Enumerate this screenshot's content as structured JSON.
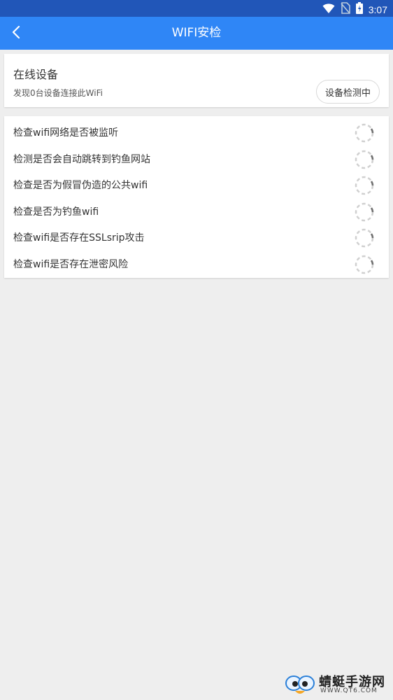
{
  "status_bar": {
    "time": "3:07"
  },
  "app_bar": {
    "title": "WIFI安检"
  },
  "online_devices": {
    "title": "在线设备",
    "subtitle": "发现0台设备连接此WiFi",
    "button_label": "设备检测中"
  },
  "checks": [
    {
      "label": "检查wifi网络是否被监听"
    },
    {
      "label": "检测是否会自动跳转到钓鱼网站"
    },
    {
      "label": "检查是否为假冒伪造的公共wifi"
    },
    {
      "label": "检查是否为钓鱼wifi"
    },
    {
      "label": "检查wifi是否存在SSLsrip攻击"
    },
    {
      "label": "检查wifi是否存在泄密风险"
    }
  ],
  "watermark": {
    "name": "蜻蜓手游网",
    "url": "WWW.QT6.COM"
  },
  "colors": {
    "status_bar": "#2156b8",
    "app_bar": "#2f86f6",
    "background": "#eeeeee"
  },
  "icons": [
    "wifi-icon",
    "no-sim-icon",
    "battery-icon",
    "back-arrow-icon",
    "loading-spinner-icon",
    "mascot-logo-icon"
  ]
}
